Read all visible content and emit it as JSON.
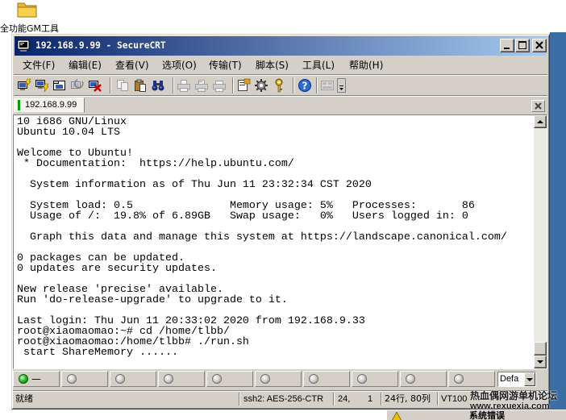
{
  "desktop": {
    "icon": "folder-icon",
    "icon_label": "全功能GM工具",
    "background": "#3a6ea5"
  },
  "window": {
    "title": "192.168.9.99 - SecureCRT",
    "app_icon": "securecrt-icon",
    "title_gradient": [
      "#0a246a",
      "#a6caf0"
    ],
    "controls": [
      "minimize-icon",
      "maximize-icon",
      "close-icon"
    ]
  },
  "menu": [
    "文件(F)",
    "编辑(E)",
    "查看(V)",
    "选项(O)",
    "传输(T)",
    "脚本(S)",
    "工具(L)",
    "帮助(H)"
  ],
  "toolbar": {
    "icons": [
      "connect-icon",
      "quick-connect-icon",
      "connect-in-tab-icon",
      "reconnect-icon",
      "disconnect-icon",
      "copy-icon",
      "paste-icon",
      "find-icon",
      "print-icon",
      "print-selection-icon",
      "print-setup-icon",
      "session-options-icon",
      "global-options-icon",
      "key-icon",
      "help-icon",
      "keymap-icon",
      "toolbar-overflow-icon"
    ]
  },
  "tab": {
    "label": "192.168.9.99",
    "status_color": "#00a000",
    "close_icon": "close-tab-icon"
  },
  "terminal": {
    "background": "#ffffff",
    "foreground": "#000000",
    "lines": [
      "10 i686 GNU/Linux",
      "Ubuntu 10.04 LTS",
      "",
      "Welcome to Ubuntu!",
      " * Documentation:  https://help.ubuntu.com/",
      "",
      "  System information as of Thu Jun 11 23:32:34 CST 2020",
      "",
      "  System load: 0.5               Memory usage: 5%   Processes:       86",
      "  Usage of /:  19.8% of 6.89GB   Swap usage:   0%   Users logged in: 0",
      "",
      "  Graph this data and manage this system at https://landscape.canonical.com/",
      "",
      "0 packages can be updated.",
      "0 updates are security updates.",
      "",
      "New release 'precise' available.",
      "Run 'do-release-upgrade' to upgrade to it.",
      "",
      "Last login: Thu Jun 11 20:33:02 2020 from 192.168.9.33",
      "root@xiaomaomao:~# cd /home/tlbb/",
      "root@xiaomaomao:/home/tlbb# ./run.sh",
      " start ShareMemory ......"
    ]
  },
  "scrollbar": {
    "up_icon": "scroll-up-icon",
    "down_icon": "scroll-down-icon"
  },
  "button_bar": {
    "slots": [
      {
        "label": "—",
        "led": "green"
      },
      {
        "label": "",
        "led": "grey"
      },
      {
        "label": "",
        "led": "grey"
      },
      {
        "label": "",
        "led": "grey"
      },
      {
        "label": "",
        "led": "grey"
      },
      {
        "label": "",
        "led": "grey"
      },
      {
        "label": "",
        "led": "grey"
      },
      {
        "label": "",
        "led": "grey"
      },
      {
        "label": "",
        "led": "grey"
      },
      {
        "label": "",
        "led": "grey"
      }
    ],
    "session_select": "Defa",
    "select_icon": "chevron-down-icon"
  },
  "statusbar": {
    "ready": "就绪",
    "protocol": "ssh2: AES-256-CTR",
    "row": "24,",
    "col": "1",
    "size": "24行, 80列",
    "terminal_type": "VT100"
  },
  "watermark": {
    "line1": "热血偶网游单机论坛",
    "line2": "www.rexuexia.com"
  },
  "taskbar_popup": {
    "icon": "warning-icon",
    "text": "系统错误"
  }
}
